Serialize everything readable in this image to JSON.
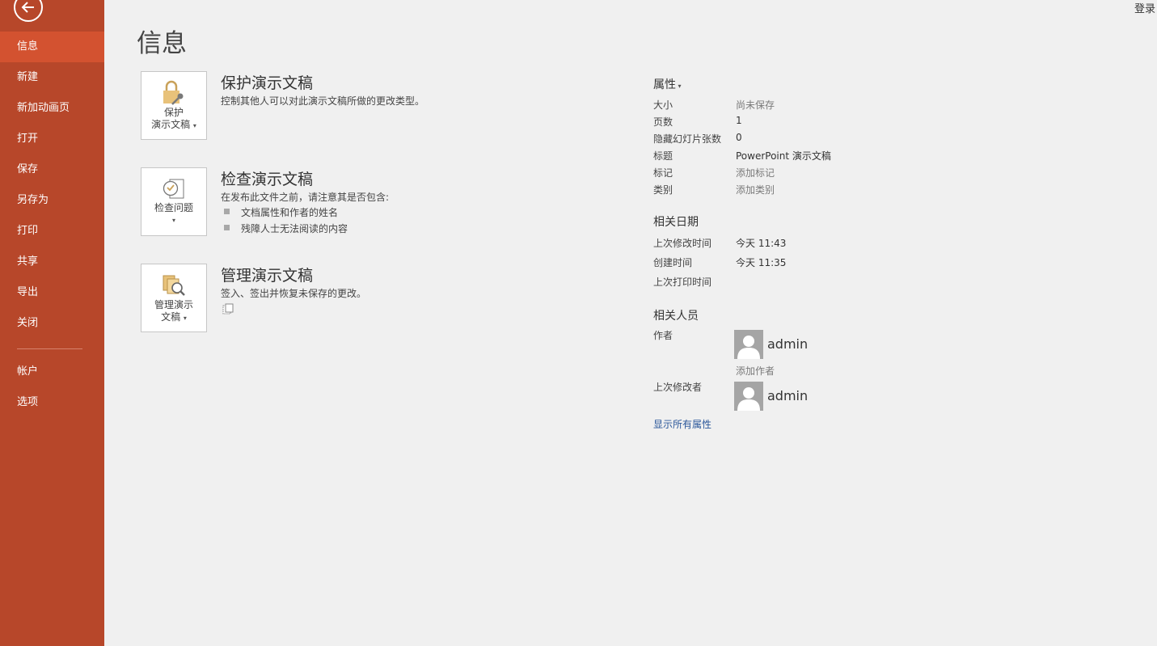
{
  "sidebar": {
    "items": [
      {
        "label": "信息",
        "active": true
      },
      {
        "label": "新建"
      },
      {
        "label": "新加动画页"
      },
      {
        "label": "打开"
      },
      {
        "label": "保存"
      },
      {
        "label": "另存为"
      },
      {
        "label": "打印"
      },
      {
        "label": "共享"
      },
      {
        "label": "导出"
      },
      {
        "label": "关闭"
      }
    ],
    "bottom_items": [
      {
        "label": "帐户"
      },
      {
        "label": "选项"
      }
    ]
  },
  "header": {
    "signin": "登录",
    "title": "信息"
  },
  "protect": {
    "button_line1": "保护",
    "button_line2": "演示文稿",
    "title": "保护演示文稿",
    "desc": "控制其他人可以对此演示文稿所做的更改类型。"
  },
  "inspect": {
    "button_label": "检查问题",
    "title": "检查演示文稿",
    "desc": "在发布此文件之前，请注意其是否包含:",
    "bullets": [
      "文档属性和作者的姓名",
      "残障人士无法阅读的内容"
    ]
  },
  "manage": {
    "button_line1": "管理演示",
    "button_line2": "文稿",
    "title": "管理演示文稿",
    "desc": "签入、签出并恢复未保存的更改。"
  },
  "properties": {
    "heading": "属性",
    "rows": [
      {
        "label": "大小",
        "value": "尚未保存"
      },
      {
        "label": "页数",
        "value": "1"
      },
      {
        "label": "隐藏幻灯片张数",
        "value": "0"
      },
      {
        "label": "标题",
        "value": "PowerPoint 演示文稿"
      },
      {
        "label": "标记",
        "value": "添加标记"
      },
      {
        "label": "类别",
        "value": "添加类别"
      }
    ]
  },
  "dates": {
    "heading": "相关日期",
    "rows": [
      {
        "label": "上次修改时间",
        "value": "今天 11:43"
      },
      {
        "label": "创建时间",
        "value": "今天 11:35"
      },
      {
        "label": "上次打印时间",
        "value": ""
      }
    ]
  },
  "people": {
    "heading": "相关人员",
    "author_label": "作者",
    "author_name": "admin",
    "add_author": "添加作者",
    "modifier_label": "上次修改者",
    "modifier_name": "admin"
  },
  "show_all": "显示所有属性",
  "colors": {
    "sidebar": "#b7472a",
    "active": "#d35230",
    "link": "#2b579a"
  }
}
